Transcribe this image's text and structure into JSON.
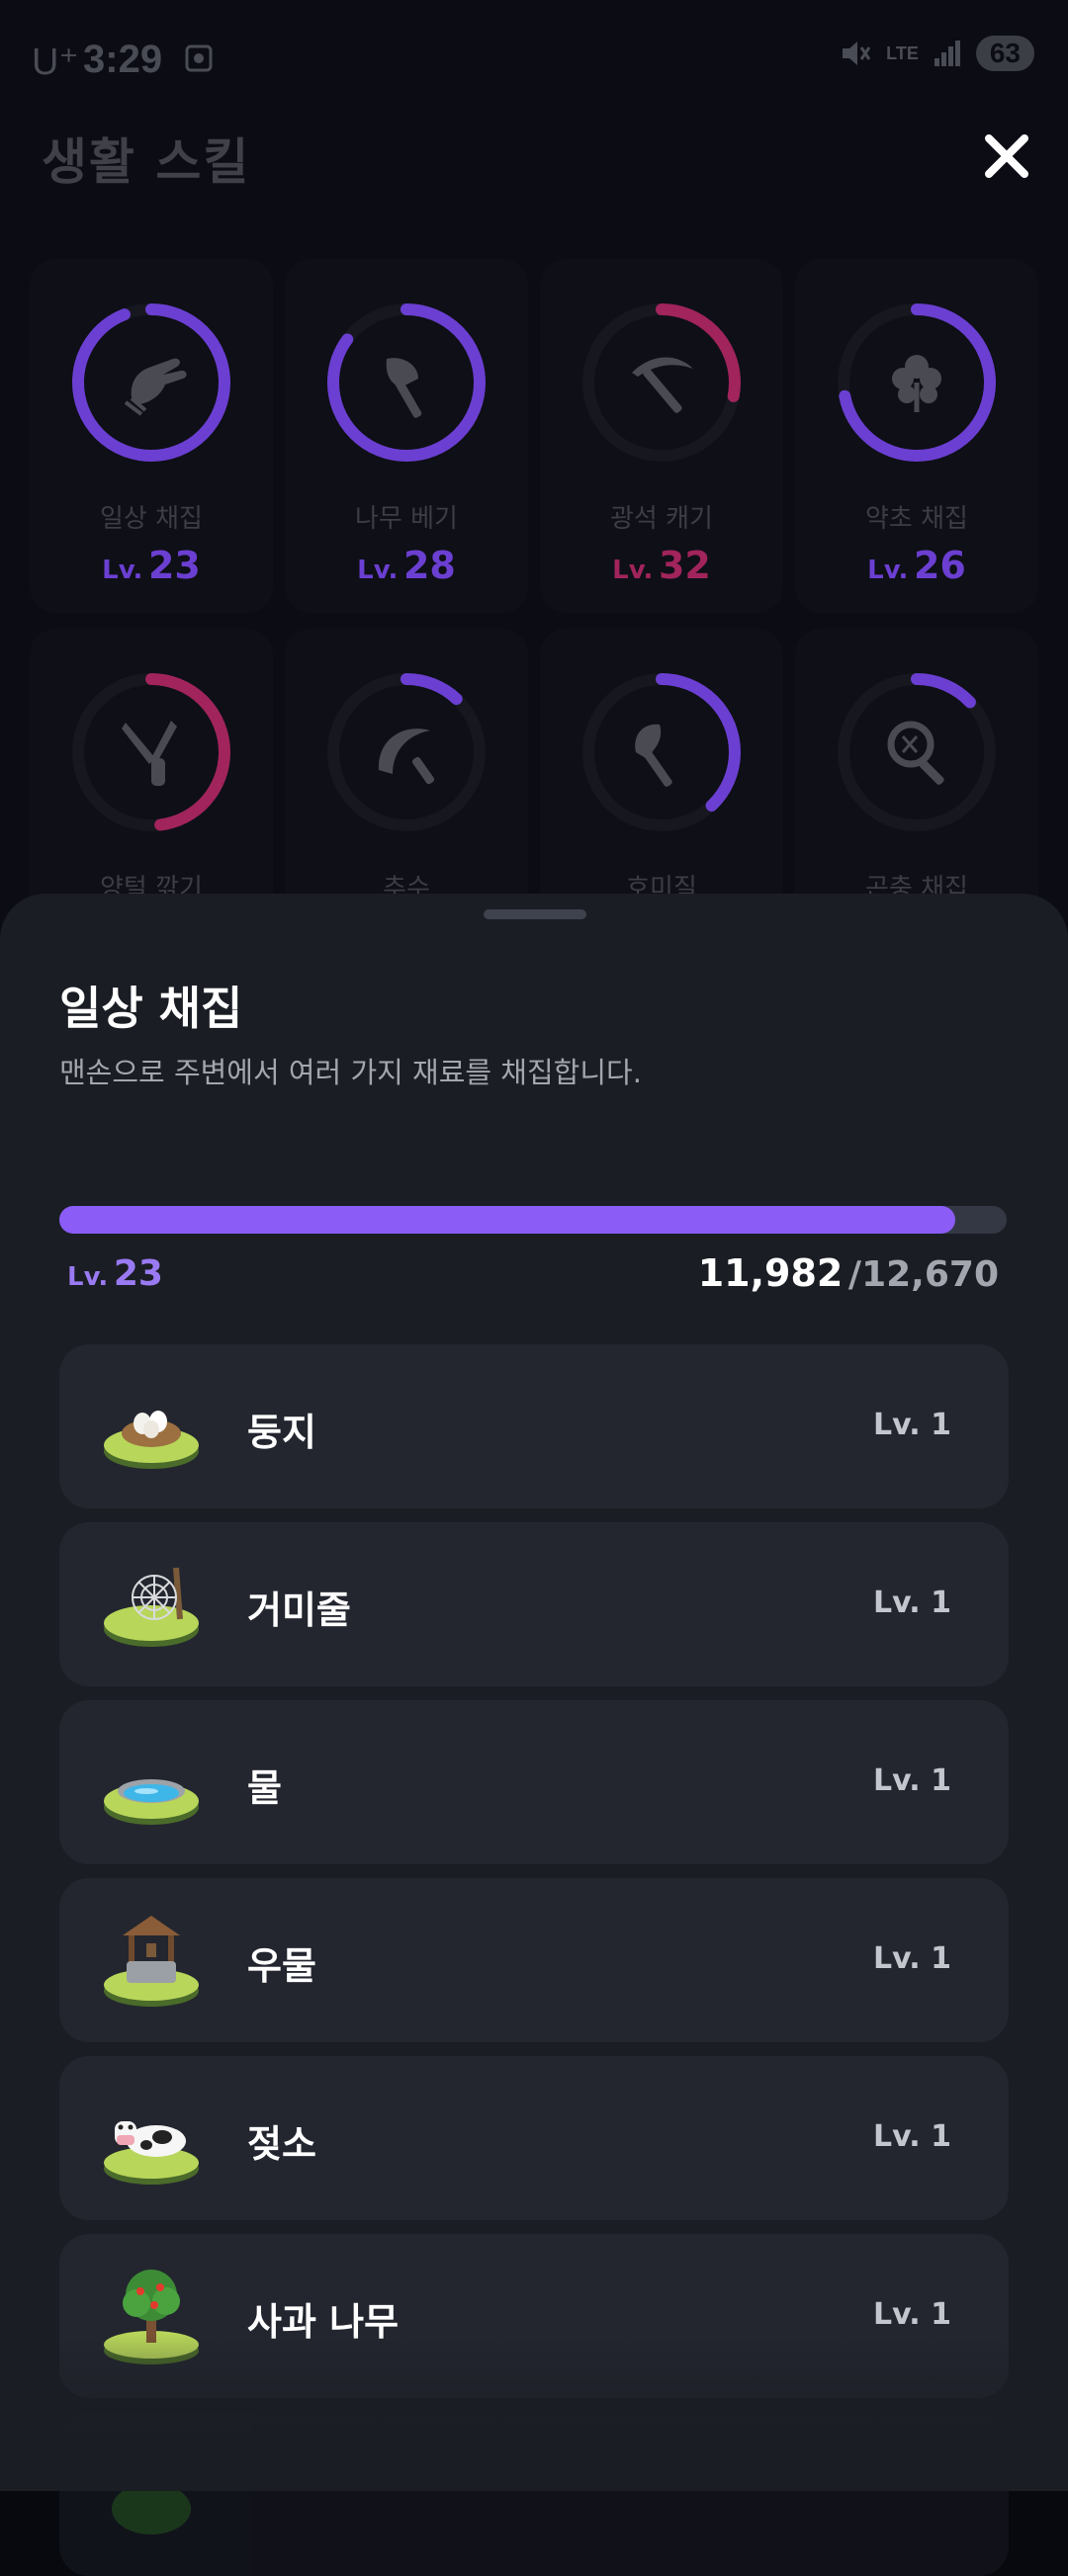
{
  "status_bar": {
    "carrier": "U⁺",
    "time": "3:29",
    "network": "LTE",
    "battery": "63"
  },
  "header": {
    "title": "생활 스킬"
  },
  "skills": [
    {
      "name": "일상 채집",
      "level_prefix": "Lv.",
      "level": "23",
      "progress": 0.94,
      "color": "#6b3fd1",
      "icon": "glove-hand-icon"
    },
    {
      "name": "나무 베기",
      "level_prefix": "Lv.",
      "level": "28",
      "progress": 0.85,
      "color": "#6b3fd1",
      "icon": "axe-icon"
    },
    {
      "name": "광석 캐기",
      "level_prefix": "Lv.",
      "level": "32",
      "progress": 0.28,
      "color": "#a1245c",
      "icon": "pickaxe-icon"
    },
    {
      "name": "약초 채집",
      "level_prefix": "Lv.",
      "level": "26",
      "progress": 0.72,
      "color": "#6b3fd1",
      "icon": "herb-icon"
    },
    {
      "name": "양털 깎기",
      "level_prefix": "",
      "level": "",
      "progress": 0.48,
      "color": "#a1245c",
      "icon": "shears-icon"
    },
    {
      "name": "추수",
      "level_prefix": "",
      "level": "",
      "progress": 0.12,
      "color": "#6b3fd1",
      "icon": "sickle-icon"
    },
    {
      "name": "호미질",
      "level_prefix": "",
      "level": "",
      "progress": 0.38,
      "color": "#6b3fd1",
      "icon": "hoe-icon"
    },
    {
      "name": "곤충 채집",
      "level_prefix": "",
      "level": "",
      "progress": 0.13,
      "color": "#6b3fd1",
      "icon": "bug-net-icon"
    }
  ],
  "sheet": {
    "title": "일상 채집",
    "description": "맨손으로 주변에서 여러 가지 재료를 채집합니다.",
    "level_prefix": "Lv.",
    "level": "23",
    "xp_current": "11,982",
    "xp_max": "/12,670",
    "xp_fraction": 0.9457,
    "accent_color": "#8b5cf6",
    "items": [
      {
        "name": "둥지",
        "level": "Lv. 1",
        "icon": "nest-icon"
      },
      {
        "name": "거미줄",
        "level": "Lv. 1",
        "icon": "spider-web-icon"
      },
      {
        "name": "물",
        "level": "Lv. 1",
        "icon": "water-pond-icon"
      },
      {
        "name": "우물",
        "level": "Lv. 1",
        "icon": "well-icon"
      },
      {
        "name": "젖소",
        "level": "Lv. 1",
        "icon": "cow-icon"
      },
      {
        "name": "사과 나무",
        "level": "Lv. 1",
        "icon": "apple-tree-icon"
      },
      {
        "name": "",
        "level": "",
        "icon": "bush-icon"
      }
    ]
  }
}
